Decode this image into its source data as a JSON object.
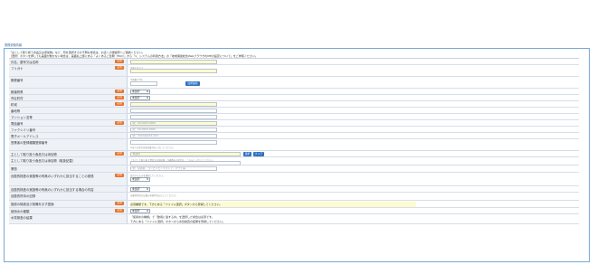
{
  "frame_title": "業務依頼情報",
  "intro": [
    "「主として取り扱う食品又は添加物」など、何を選択するか不明な場合は、お近くの保健所へご相談ください。",
    "［選択］ボタンを押しても画面が動かない場合は、画面右上部にある「よくあるご質問（FAQ）」から「1．システムの利用方法」の「地域保健総合WebブラウザのMEの設定について」をご参照ください。"
  ],
  "required_label": "必須",
  "rows": [
    {
      "label": "氏名、屋号又は名称",
      "required": true
    },
    {
      "label": "フリガナ",
      "required": true,
      "hint": "全角カタカナ"
    },
    {
      "label": "郵便番号",
      "note": "半角数字7桁",
      "button": "住所検索"
    },
    {
      "label": "都道府県",
      "required": true,
      "select": "未選択"
    },
    {
      "label": "市区町村",
      "required": true,
      "select": "未選択"
    },
    {
      "label": "町域",
      "required": true
    },
    {
      "label": "番地等"
    },
    {
      "label": "マンション名等"
    },
    {
      "label": "電話番号",
      "required": true,
      "placeholder": "例：00-0000-0000"
    },
    {
      "label": "ファクシミリ番号",
      "placeholder": "例：00-0000-0000"
    },
    {
      "label": "電子メールアドレス",
      "placeholder": "例：XXXX@XXX.XXX"
    },
    {
      "label": "営業者の登録種類登録番号",
      "note": "※法人の場合は登記番号を入力してください。"
    },
    {
      "label": "主として取り扱う食品又は添加物",
      "required": true,
      "select": "未選択",
      "buttons": [
        "選択",
        "クリア"
      ]
    },
    {
      "label": "主として取り扱う食品又は添加物（取扱記載）",
      "note": "「主として取り扱う食品又は添加物」が複数ある場合は、こちらに入力してください。"
    },
    {
      "label": "業態",
      "placeholder": "例：居酒屋、コンビニエンスストア、カフェ等"
    },
    {
      "label": "自動的検査の実施等の有無のいずれかに該当することの実態",
      "required": true,
      "select": "未選択",
      "note": "該当するものを選択してください。"
    },
    {
      "label": "自動的検査の実施等の有無のいずれかに該当する場合の内容",
      "select": "未選択"
    },
    {
      "label": "自動的所持の記録",
      "note": "自動的所持の記録の有無等を記入してください。"
    },
    {
      "label": "施設の構造及び設備を示す図面",
      "required": true,
      "message": "必須書類です。下方にある「ファイル選択」ボタンから登録してください。"
    },
    {
      "label": "使用水の種類",
      "required": true,
      "select": "未選択"
    },
    {
      "label": "水質検査の結果",
      "message2": [
        "「使用水の種類」で「飲用に適する水」を選択した場合は必須です。",
        "下方にある「ファイル選択」ボタンから水質検査の結果を登録してください。"
      ]
    }
  ]
}
